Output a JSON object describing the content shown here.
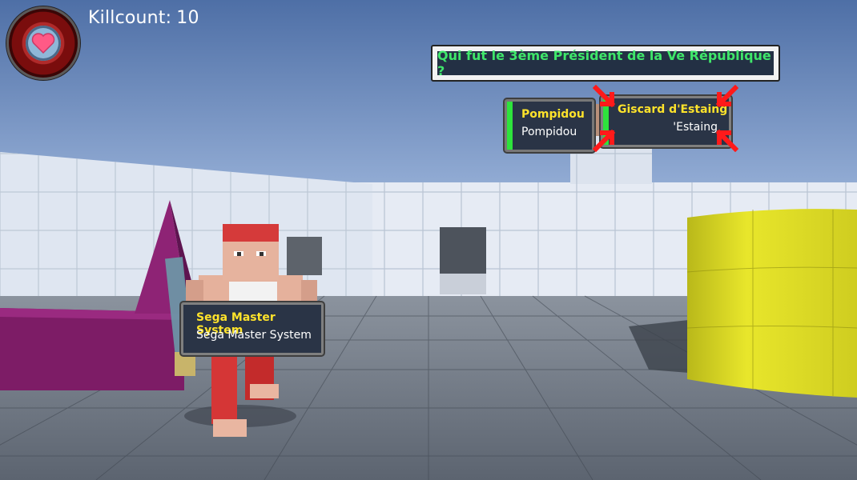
{
  "hud": {
    "killcount_label": "Killcount:",
    "killcount_value": "10",
    "health_icon": "heart-icon"
  },
  "question": {
    "text": "Qui fut le 3ème Président de la Ve République ?"
  },
  "answers": [
    {
      "main": "Pompidou",
      "sub": "Pompidou"
    },
    {
      "main": "Giscard d'Estaing",
      "sub": "'Estaing"
    }
  ],
  "enemy_label": {
    "main": "Sega Master System",
    "sub": "Sega Master System"
  },
  "colors": {
    "question_text": "#3fe66a",
    "answer_highlight": "#ffe32b",
    "answer_bar": "#2ee33c",
    "target_arrows": "#ff1a1a",
    "health_ring": "#8a0e0e"
  }
}
